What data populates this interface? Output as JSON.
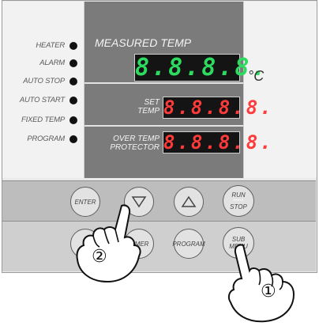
{
  "indicators": [
    {
      "label": "HEATER"
    },
    {
      "label": "ALARM"
    },
    {
      "label": "AUTO STOP"
    },
    {
      "label": "AUTO START"
    },
    {
      "label": "FIXED TEMP"
    },
    {
      "label": "PROGRAM"
    }
  ],
  "display": {
    "measured_title": "MEASURED TEMP",
    "measured_value": "8.8.8.8.",
    "unit": "°C",
    "set_label_1": "SET",
    "set_label_2": "TEMP",
    "set_value": "8.8.8.8.",
    "over_label_1": "OVER TEMP",
    "over_label_2": "PROTECTOR",
    "over_value": "8.8.8.8."
  },
  "buttons": {
    "enter": "ENTER",
    "run": "RUN",
    "run_dots": "•••••",
    "stop": "STOP",
    "timer": "TIMER",
    "program": "PROGRAM",
    "sub_1": "SUB",
    "sub_2": "MENU"
  },
  "callouts": {
    "one": "①",
    "two": "②"
  },
  "colors": {
    "green_digits": "#2edb61",
    "red_digits": "#ff3a3a",
    "display_bg": "#7b7b7b"
  }
}
